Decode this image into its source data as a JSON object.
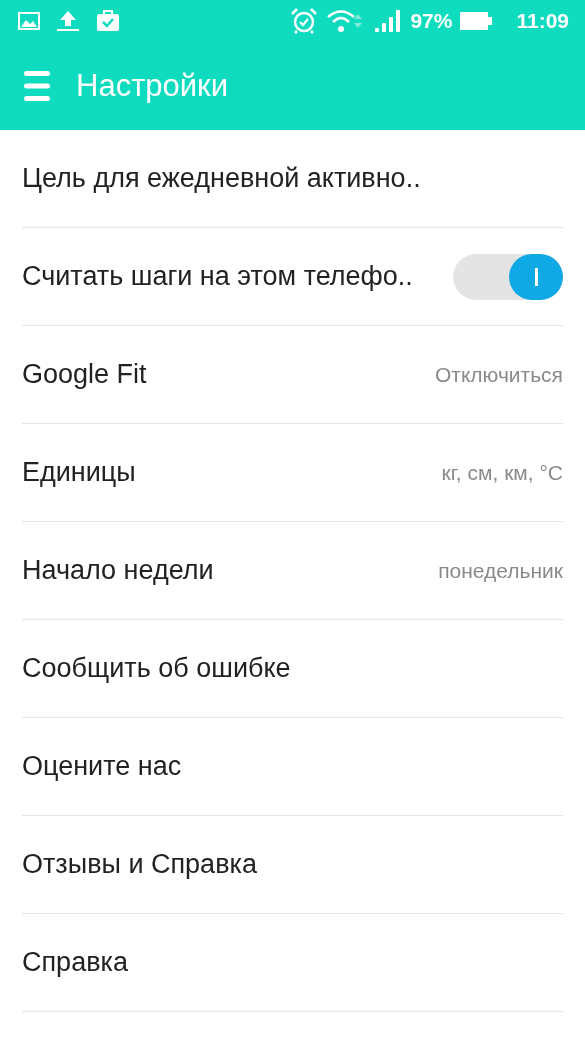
{
  "status_bar": {
    "battery": "97%",
    "time": "11:09"
  },
  "app_bar": {
    "title": "Настройки"
  },
  "settings": [
    {
      "kind": "plain",
      "label": "Цель для ежедневной активно.."
    },
    {
      "kind": "toggle",
      "label": "Считать шаги на этом телефо..",
      "on": true
    },
    {
      "kind": "value",
      "label": "Google Fit",
      "value": "Отключиться"
    },
    {
      "kind": "value",
      "label": "Единицы",
      "value": "кг, см, км, °C"
    },
    {
      "kind": "value",
      "label": "Начало недели",
      "value": "понедельник"
    },
    {
      "kind": "plain",
      "label": "Сообщить об ошибке"
    },
    {
      "kind": "plain",
      "label": "Оцените нас"
    },
    {
      "kind": "plain",
      "label": "Отзывы и Справка"
    },
    {
      "kind": "plain",
      "label": "Справка"
    }
  ]
}
